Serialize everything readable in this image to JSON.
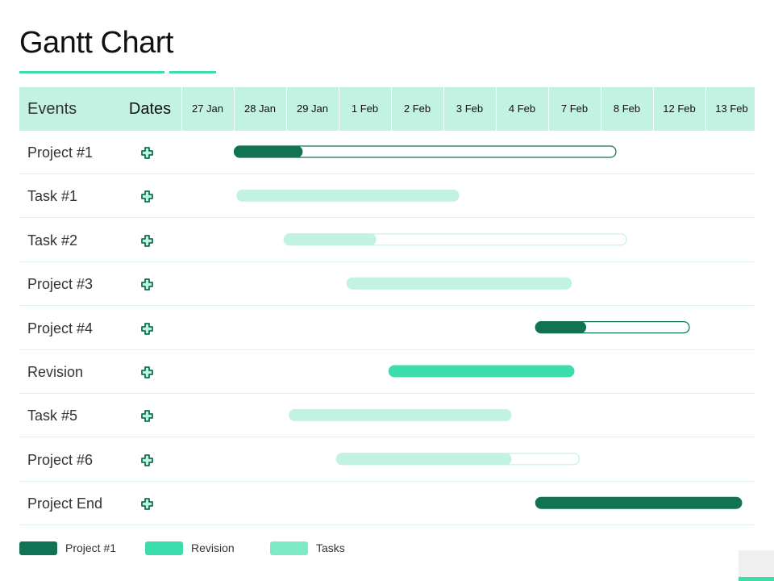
{
  "title": "Gantt Chart",
  "header": {
    "events_label": "Events",
    "dates_label": "Dates"
  },
  "colors": {
    "header_bg": "#c1f2e2",
    "accent": "#3ddcad",
    "project_dark": "#117354",
    "revision": "#3ddcad",
    "tasks_light": "#c1f2e2",
    "legend_tasks": "#7eeac6",
    "row_divider": "#d6f4ea"
  },
  "chart_data": {
    "type": "gantt",
    "title": "Gantt Chart",
    "columns": [
      "27 Jan",
      "28 Jan",
      "29 Jan",
      "1 Feb",
      "2 Feb",
      "3 Feb",
      "4 Feb",
      "7 Feb",
      "8 Feb",
      "12 Feb",
      "13 Feb"
    ],
    "tasks": [
      {
        "name": "Project #1",
        "category": "project",
        "start": 1.0,
        "end": 8.3,
        "progress": 0.18
      },
      {
        "name": "Task #1",
        "category": "task",
        "start": 1.05,
        "end": 5.3,
        "progress": 1.0
      },
      {
        "name": "Task #2",
        "category": "task",
        "start": 1.95,
        "end": 8.5,
        "progress": 0.27
      },
      {
        "name": "Project #3",
        "category": "task",
        "start": 3.15,
        "end": 7.45,
        "progress": 1.0
      },
      {
        "name": "Project #4",
        "category": "project",
        "start": 6.75,
        "end": 9.7,
        "progress": 0.33
      },
      {
        "name": "Revision",
        "category": "revision",
        "start": 3.95,
        "end": 7.5,
        "progress": 1.0
      },
      {
        "name": "Task #5",
        "category": "task",
        "start": 2.05,
        "end": 6.3,
        "progress": 1.0
      },
      {
        "name": "Project #6",
        "category": "task",
        "start": 2.95,
        "end": 7.6,
        "progress": 0.72
      },
      {
        "name": "Project End",
        "category": "project",
        "start": 6.75,
        "end": 10.7,
        "progress": 1.0
      }
    ],
    "legend": [
      {
        "label": "Project #1",
        "color": "#117354"
      },
      {
        "label": "Revision",
        "color": "#3ddcad"
      },
      {
        "label": "Tasks",
        "color": "#7eeac6"
      }
    ]
  }
}
